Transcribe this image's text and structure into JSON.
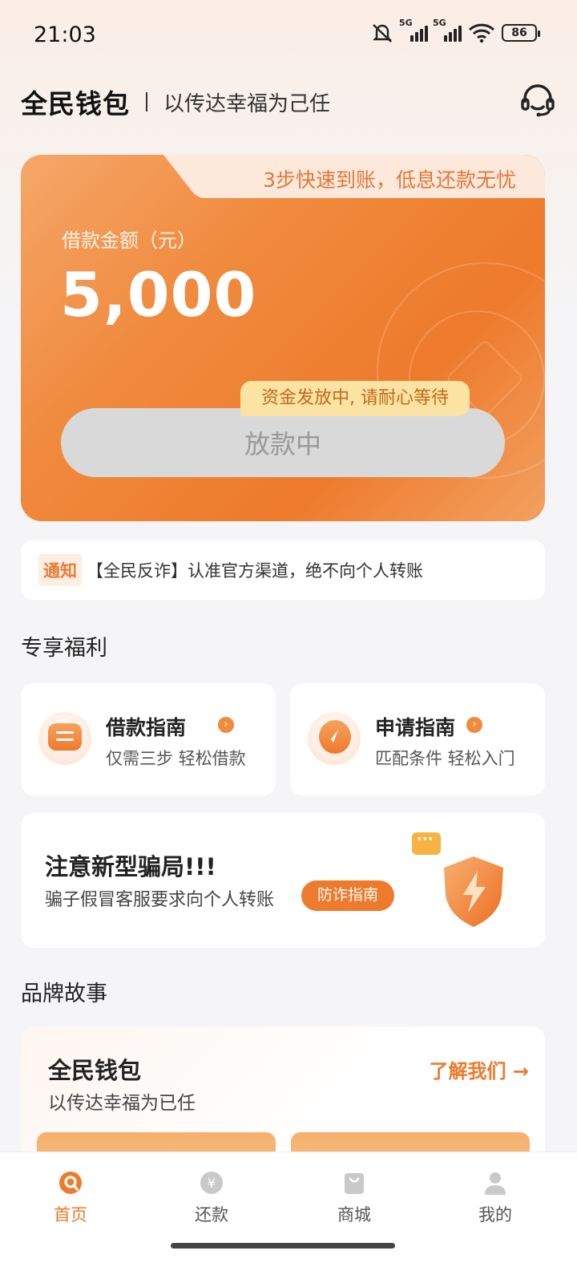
{
  "status_bar": {
    "time": "21:03",
    "network_1": "5G",
    "network_2": "5G",
    "battery": "86"
  },
  "header": {
    "brand": "全民钱包",
    "slogan": "以传达幸福为己任",
    "support_icon": "headset-icon"
  },
  "loan_card": {
    "promo": "3步快速到账，低息还款无忧",
    "amount_label": "借款金额（元）",
    "amount": "5,000",
    "status_bubble": "资金发放中, 请耐心等待",
    "button_label": "放款中",
    "colors": {
      "accent": "#ee7a2c",
      "button_disabled": "#d9d9d9"
    }
  },
  "notice": {
    "tag": "通知",
    "text": "【全民反诈】认准官方渠道，绝不向个人转账"
  },
  "benefits": {
    "title": "专享福利",
    "items": [
      {
        "title": "借款指南",
        "subtitle": "仅需三步 轻松借款",
        "icon": "document-icon"
      },
      {
        "title": "申请指南",
        "subtitle": "匹配条件 轻松入门",
        "icon": "compass-icon"
      }
    ]
  },
  "fraud": {
    "title": "注意新型骗局!!!",
    "subtitle": "骗子假冒客服要求向个人转账",
    "button": "防诈指南",
    "icon": "shield-lightning-icon"
  },
  "brand_story": {
    "title": "品牌故事",
    "card_title": "全民钱包",
    "card_subtitle": "以传达幸福为已任",
    "link": "了解我们 →"
  },
  "tabbar": {
    "items": [
      {
        "label": "首页",
        "icon": "home-icon",
        "active": true
      },
      {
        "label": "还款",
        "icon": "yuan-icon",
        "active": false
      },
      {
        "label": "商城",
        "icon": "shopping-bag-icon",
        "active": false
      },
      {
        "label": "我的",
        "icon": "user-icon",
        "active": false
      }
    ]
  }
}
